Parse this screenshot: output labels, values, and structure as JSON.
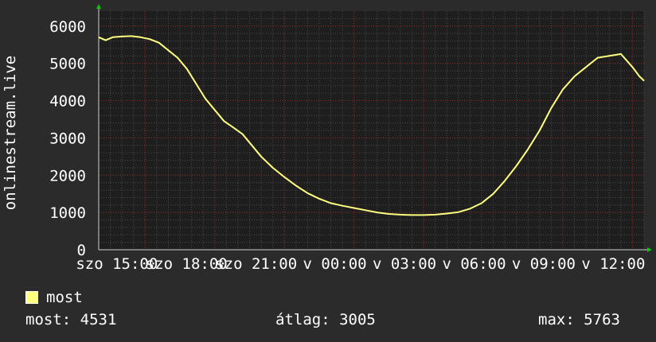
{
  "colors": {
    "background": "#2b2b2b",
    "plot_background": "#1e1e1e",
    "grid_major": "#8b2a2a",
    "grid_minor": "#4a4a4a",
    "line": "#ffff80",
    "axis": "#d0d0d0",
    "arrow": "#00cc00",
    "text": "#ffffff"
  },
  "legend": {
    "label": "most"
  },
  "stats": {
    "current": "most: 4531",
    "average": "átlag: 3005",
    "max": "max: 5763"
  },
  "chart_data": {
    "type": "line",
    "ylabel": "onlinestream.live",
    "ylim": [
      0,
      6400
    ],
    "yticks": [
      0,
      1000,
      2000,
      3000,
      4000,
      5000,
      6000
    ],
    "xlim": [
      13.0,
      36.5
    ],
    "xticks": [
      {
        "x": 15,
        "label": "szo 15:00"
      },
      {
        "x": 18,
        "label": "szo 18:00"
      },
      {
        "x": 21,
        "label": "szo 21:00"
      },
      {
        "x": 24,
        "label": "v 00:00"
      },
      {
        "x": 27,
        "label": "v 03:00"
      },
      {
        "x": 30,
        "label": "v 06:00"
      },
      {
        "x": 33,
        "label": "v 09:00"
      },
      {
        "x": 36,
        "label": "v 12:00"
      }
    ],
    "grid": true,
    "series": [
      {
        "values_x": [
          13.0,
          13.3,
          13.6,
          14.0,
          14.4,
          14.8,
          15.2,
          15.6,
          16.0,
          16.4,
          16.8,
          17.2,
          17.6,
          18.0,
          18.4,
          18.8,
          19.2,
          19.6,
          20.0,
          20.5,
          21.0,
          21.5,
          22.0,
          22.5,
          23.0,
          23.5,
          24.0,
          24.5,
          25.0,
          25.5,
          26.0,
          26.5,
          27.0,
          27.5,
          28.0,
          28.5,
          29.0,
          29.5,
          30.0,
          30.5,
          31.0,
          31.5,
          32.0,
          32.5,
          33.0,
          33.5,
          34.0,
          34.5,
          35.0,
          35.5,
          36.0,
          36.3,
          36.5
        ],
        "values_y": [
          5700,
          5620,
          5700,
          5720,
          5730,
          5700,
          5650,
          5550,
          5350,
          5150,
          4850,
          4450,
          4050,
          3750,
          3450,
          3280,
          3100,
          2800,
          2500,
          2200,
          1950,
          1720,
          1520,
          1370,
          1250,
          1180,
          1120,
          1060,
          1000,
          960,
          940,
          930,
          930,
          940,
          970,
          1010,
          1100,
          1250,
          1500,
          1850,
          2250,
          2700,
          3200,
          3800,
          4300,
          4650,
          4900,
          5150,
          5200,
          5250,
          4900,
          4650,
          4531
        ]
      }
    ]
  }
}
